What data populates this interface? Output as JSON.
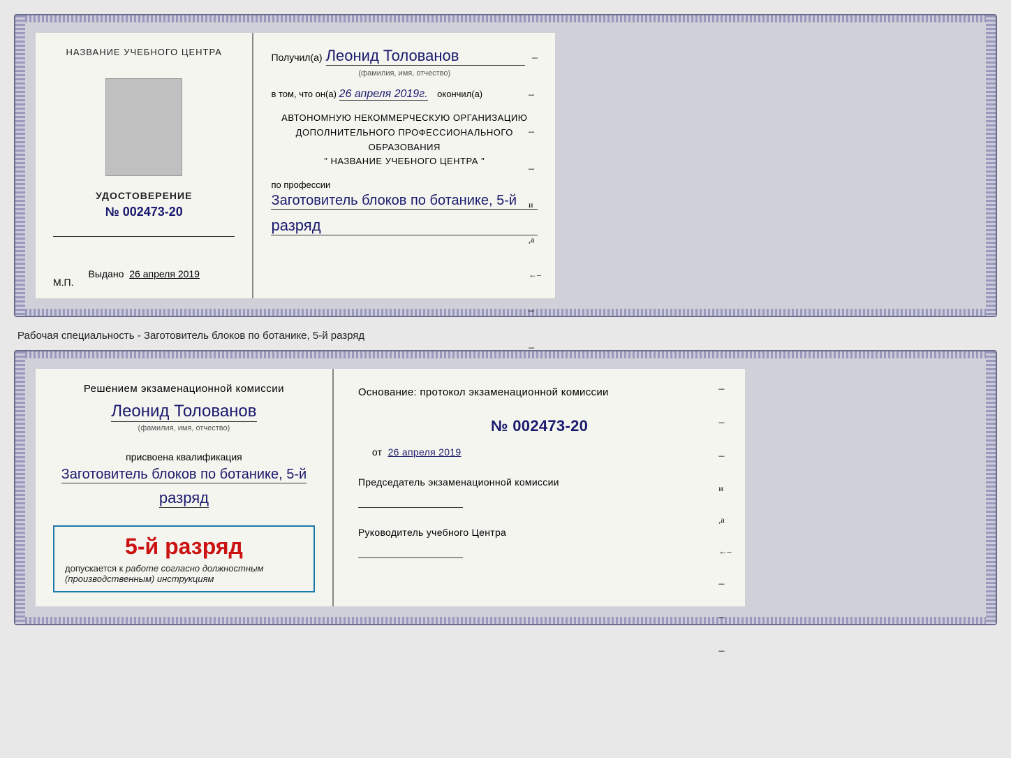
{
  "doc1": {
    "left": {
      "title": "НАЗВАНИЕ УЧЕБНОГО ЦЕНТРА",
      "cert_title": "УДОСТОВЕРЕНИЕ",
      "cert_number": "№ 002473-20",
      "issued_label": "Выдано",
      "issued_date": "26 апреля 2019",
      "mp_label": "М.П."
    },
    "right": {
      "recipient_label": "Получил(а)",
      "recipient_name": "Леонид Толованов",
      "fio_subtitle": "(фамилия, имя, отчество)",
      "body_text": "в том, что он(а)",
      "date_value": "26 апреля 2019г.",
      "finished_label": "окончил(а)",
      "org_line1": "АВТОНОМНУЮ НЕКОММЕРЧЕСКУЮ ОРГАНИЗАЦИЮ",
      "org_line2": "ДОПОЛНИТЕЛЬНОГО ПРОФЕССИОНАЛЬНОГО ОБРАЗОВАНИЯ",
      "org_line3": "\" НАЗВАНИЕ УЧЕБНОГО ЦЕНТРА \"",
      "profession_label": "по профессии",
      "profession_value": "Заготовитель блоков по ботанике, 5-й",
      "razryad_value": "разряд"
    }
  },
  "caption": "Рабочая специальность - Заготовитель блоков по ботанике, 5-й разряд",
  "doc2": {
    "left": {
      "commission_text": "Решением экзаменационной комиссии",
      "person_name": "Леонид Толованов",
      "fio_subtitle": "(фамилия, имя, отчество)",
      "qualification_label": "присвоена квалификация",
      "qualification_value": "Заготовитель блоков по ботанике, 5-й",
      "razryad_value": "разряд",
      "stamp_rank": "5-й разряд",
      "stamp_admit_text": "допускается к",
      "stamp_admit_italic": "работе согласно должностным (производственным) инструкциям"
    },
    "right": {
      "basis_label": "Основание: протокол экзаменационной комиссии",
      "protocol_number": "№  002473-20",
      "from_label": "от",
      "from_date": "26 апреля 2019",
      "chairman_label": "Председатель экзаменационной комиссии",
      "director_label": "Руководитель учебного Центра"
    }
  }
}
